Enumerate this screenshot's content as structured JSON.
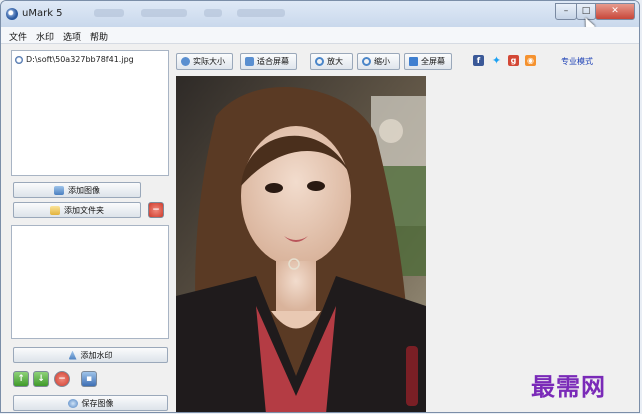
{
  "window": {
    "title": "uMark 5"
  },
  "menu": [
    "文件",
    "水印",
    "选项",
    "帮助"
  ],
  "files": [
    "D:\\soft\\50a327bb78f41.jpg"
  ],
  "left_buttons": {
    "add_image": "添加图像",
    "add_folder": "添加文件夹",
    "add_watermark": "添加水印",
    "save_image": "保存图像"
  },
  "toolbar": {
    "actual_size": "实际大小",
    "fit_screen": "适合屏幕",
    "zoom_in": "放大",
    "zoom_out": "缩小",
    "fullscreen": "全屏幕"
  },
  "social_icons": [
    "facebook-icon",
    "twitter-icon",
    "google-plus-icon",
    "rss-icon"
  ],
  "pro_mode": "专业模式",
  "site_watermark": "最需网",
  "colors": {
    "accent": "#1b3fb5",
    "watermark": "#7a2ab8",
    "close_button": "#c8473a"
  }
}
